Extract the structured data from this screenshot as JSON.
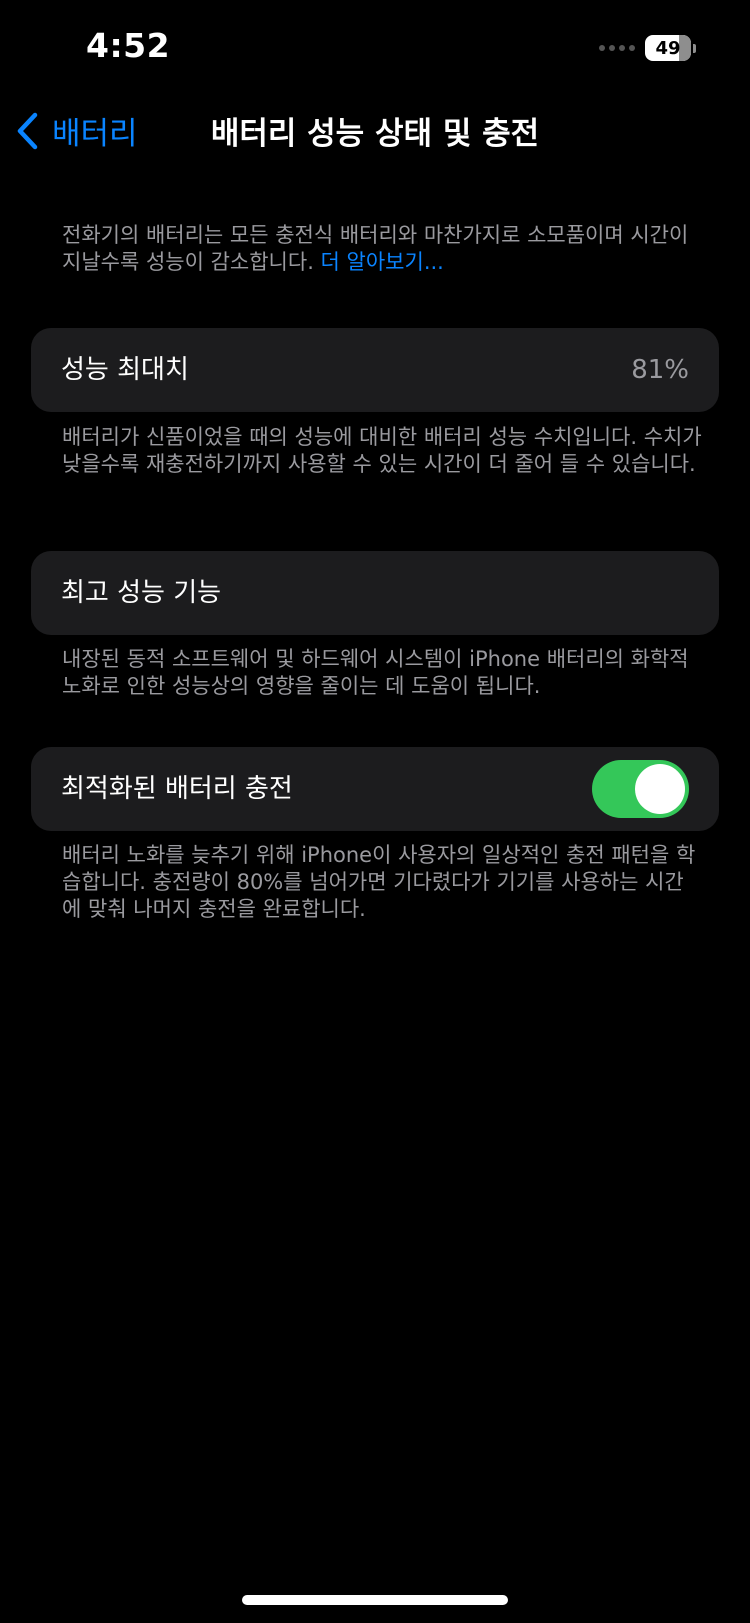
{
  "status_bar": {
    "time": "4:52",
    "battery_level": "49"
  },
  "nav": {
    "back_label": "배터리",
    "title": "배터리 성능 상태 및 충전"
  },
  "intro": {
    "text": "전화기의 배터리는 모든 충전식 배터리와 마찬가지로 소모품이며 시간이 지날수록 성능이 감소합니다. ",
    "link": "더 알아보기..."
  },
  "max_capacity": {
    "label": "성능 최대치",
    "value": "81%",
    "footnote": "배터리가 신품이었을 때의 성능에 대비한 배터리 성능 수치입니다. 수치가 낮을수록 재충전하기까지 사용할 수 있는 시간이 더 줄어 들 수 있습니다."
  },
  "peak_performance": {
    "label": "최고 성능 기능",
    "footnote": "내장된 동적 소프트웨어 및 하드웨어 시스템이 iPhone 배터리의 화학적 노화로 인한 성능상의 영향을 줄이는 데 도움이 됩니다."
  },
  "optimized_charging": {
    "label": "최적화된 배터리 충전",
    "enabled": true,
    "footnote": "배터리 노화를 늦추기 위해 iPhone이 사용자의 일상적인 충전 패턴을 학습합니다. 충전량이 80%를 넘어가면 기다렸다가 기기를 사용하는 시간에 맞춰 나머지 충전을 완료합니다."
  },
  "colors": {
    "background": "#000000",
    "card": "#1c1c1e",
    "accent": "#0a84ff",
    "toggle_on": "#34c759",
    "secondary_text": "#9a9a9f"
  }
}
